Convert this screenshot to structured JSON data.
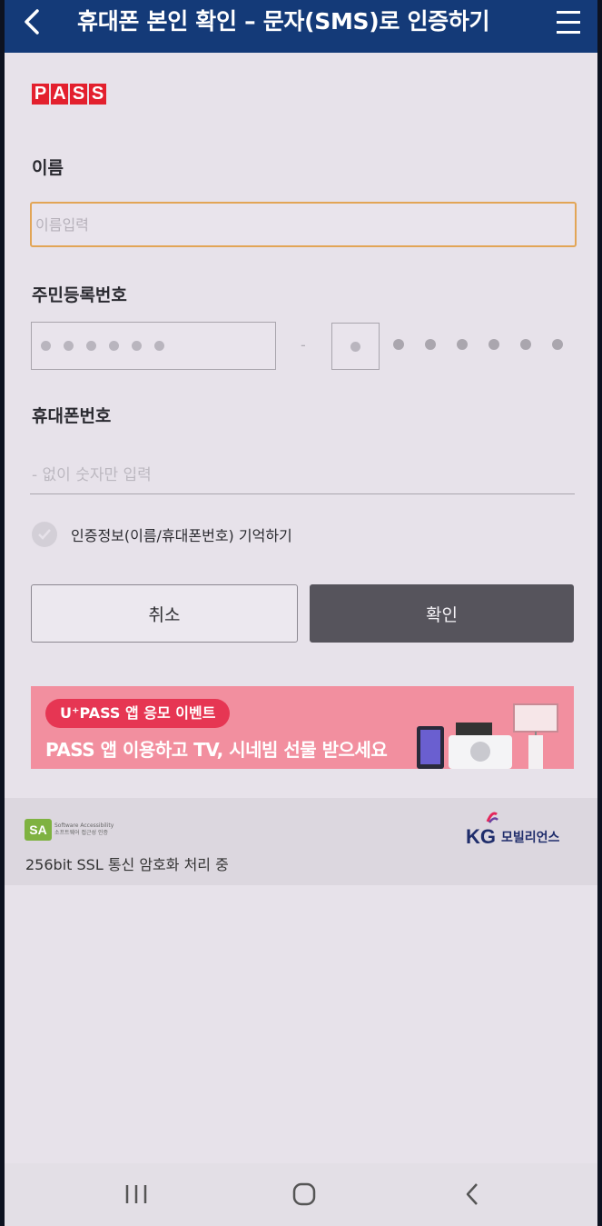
{
  "header": {
    "title": "휴대폰 본인 확인 – 문자(SMS)로 인증하기",
    "back_icon": "chevron-left-icon",
    "menu_icon": "hamburger-menu-icon",
    "color": "#143a78"
  },
  "brand": {
    "logo_letters": [
      "P",
      "A",
      "S",
      "S"
    ],
    "color": "#e3202e"
  },
  "form": {
    "name_label": "이름",
    "name_placeholder": "이름입력",
    "rrn_label": "주민등록번호",
    "rrn_separator": "-",
    "phone_label": "휴대폰번호",
    "phone_placeholder": "- 없이 숫자만 입력",
    "remember_label": "인증정보(이름/휴대폰번호) 기억하기",
    "focus_color": "#e2a556"
  },
  "buttons": {
    "cancel": "취소",
    "confirm": "확인"
  },
  "banner": {
    "tag": "U⁺PASS 앱 응모 이벤트",
    "text": "PASS 앱 이용하고 TV, 시네빔 선물 받으세요",
    "background": "#f28f9f"
  },
  "footer": {
    "sa_mark": "SA",
    "sa_caption": "Software Accessibility 소프트웨어 접근성 인증",
    "ssl_text": "256bit SSL 통신 암호화 처리 중",
    "partner_mark": "KG",
    "partner_name": "모빌리언스"
  },
  "navbar": {
    "icons": [
      "recent-apps-icon",
      "home-icon",
      "back-icon"
    ]
  }
}
